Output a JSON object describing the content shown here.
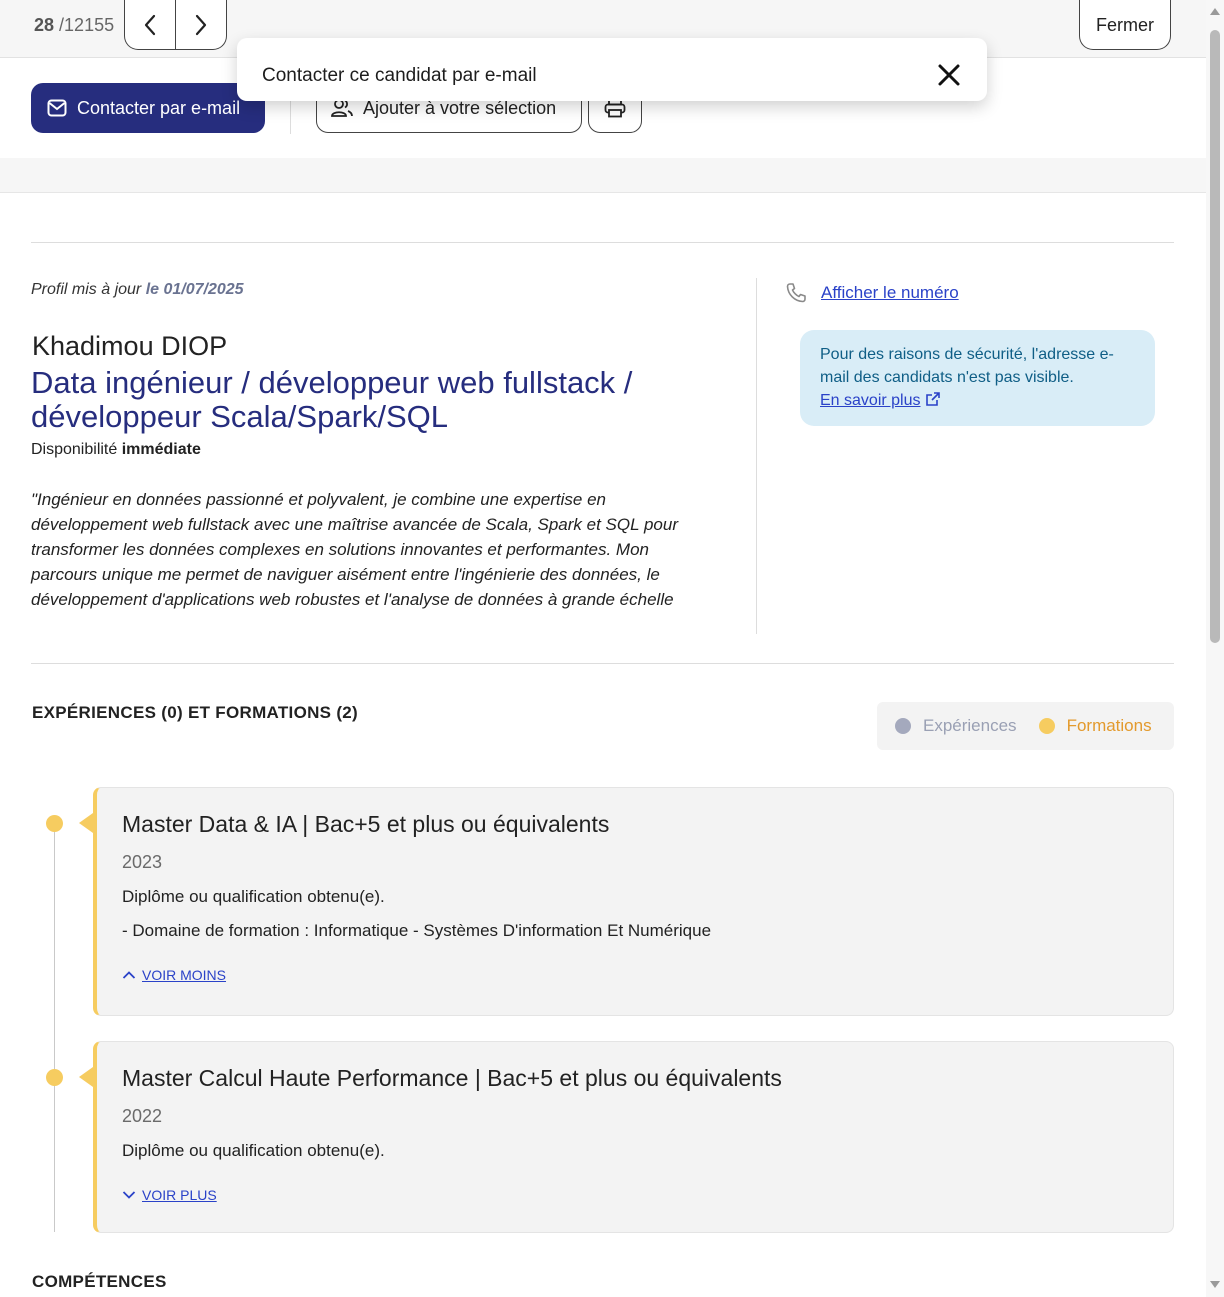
{
  "nav": {
    "current": "28",
    "total": "/12155",
    "close_label": "Fermer"
  },
  "actions": {
    "contact_label": "Contacter par e-mail",
    "add_selection_label": "Ajouter à votre sélection"
  },
  "tooltip": {
    "text": "Contacter ce candidat par e-mail"
  },
  "profile": {
    "updated_prefix": "Profil mis à jour",
    "updated_date": "le 01/07/2025",
    "name": "Khadimou DIOP",
    "title": "Data ingénieur / développeur web fullstack / développeur Scala/Spark/SQL",
    "availability_label": "Disponibilité",
    "availability_value": "immédiate",
    "summary": "\"Ingénieur en données passionné et polyvalent, je combine une expertise en développement web fullstack avec une maîtrise avancée de Scala, Spark et SQL pour transformer les données complexes en solutions innovantes et performantes. Mon parcours unique me permet de naviguer aisément entre l'ingénierie des données, le développement d'applications web robustes et l'analyse de données à grande échelle"
  },
  "contact": {
    "phone_link": "Afficher le numéro",
    "security_text": "Pour des raisons de sécurité, l'adresse e-mail des candidats n'est pas visible.",
    "learn_more": "En savoir plus"
  },
  "experience_section": {
    "title": "EXPÉRIENCES (0) ET FORMATIONS (2)",
    "legend_experiences": "Expériences",
    "legend_formations": "Formations",
    "colors": {
      "experiences": "#a4a9bd",
      "formations": "#f6cc60",
      "formations_text": "#e39a2d"
    },
    "items": [
      {
        "title_main": "Master Data & IA",
        "title_level": "| Bac+5 et plus ou équivalents",
        "year": "2023",
        "lines": [
          "Diplôme ou qualification obtenu(e).",
          "- Domaine de formation : Informatique - Systèmes D'information Et Numérique"
        ],
        "toggle": "VOIR MOINS"
      },
      {
        "title_main": "Master Calcul Haute Performance",
        "title_level": "| Bac+5 et plus ou équivalents",
        "year": "2022",
        "lines": [
          "Diplôme ou qualification obtenu(e)."
        ],
        "toggle": "VOIR PLUS"
      }
    ]
  },
  "skills_section": {
    "title": "COMPÉTENCES"
  },
  "theme": {
    "primary": "#262d7e",
    "link": "#2a42c8",
    "info_bg": "#d9edf7"
  }
}
